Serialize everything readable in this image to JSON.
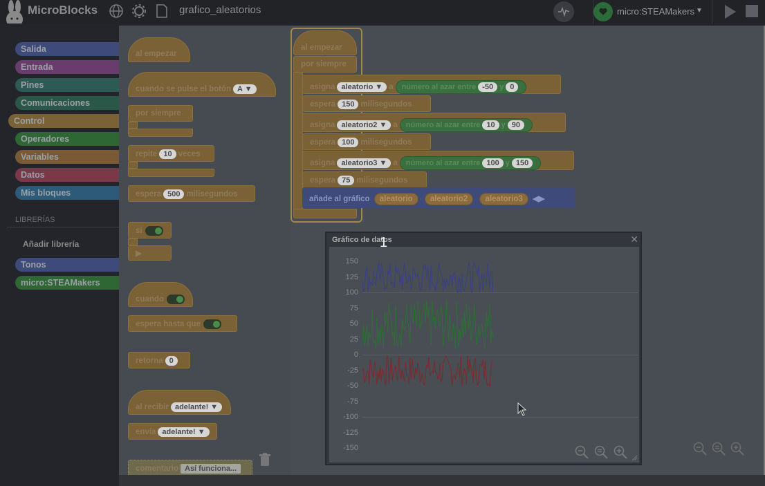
{
  "topbar": {
    "app_title": "MicroBlocks",
    "project_name": "grafico_aleatorios",
    "board_name": "micro:STEAMakers",
    "icons": [
      "globe-icon",
      "gear-icon",
      "file-icon",
      "graph-icon",
      "play-icon",
      "stop-icon"
    ]
  },
  "categories": [
    {
      "label": "Salida",
      "color": "#3e4a7a"
    },
    {
      "label": "Entrada",
      "color": "#6a3c6e"
    },
    {
      "label": "Pines",
      "color": "#2e5a56"
    },
    {
      "label": "Comunicaciones",
      "color": "#2a5848"
    },
    {
      "label": "Control",
      "color": "#7a6136"
    },
    {
      "label": "Operadores",
      "color": "#2e6634"
    },
    {
      "label": "Variables",
      "color": "#7a5a34"
    },
    {
      "label": "Datos",
      "color": "#7a3848"
    },
    {
      "label": "Mis bloques",
      "color": "#2e5a7a"
    }
  ],
  "libraries": {
    "title": "LIBRERÍAS",
    "add_label": "Añadir librería",
    "items": [
      {
        "label": "Tonos",
        "color": "#3e4a7a"
      },
      {
        "label": "micro:STEAMakers",
        "color": "#2e6634"
      }
    ]
  },
  "palette": {
    "when_started": "al empezar",
    "when_button": "cuando se pulse el botón",
    "button_value": "A",
    "forever": "por siempre",
    "repeat_pre": "repite",
    "repeat_value": "10",
    "repeat_post": "veces",
    "wait_pre": "espera",
    "wait_value": "500",
    "wait_post": "milisegundos",
    "if": "si",
    "when": "cuando",
    "wait_until": "espera hasta que",
    "return": "retorna",
    "return_value": "0",
    "when_receive": "al recibir",
    "receive_value": "adelante!",
    "send": "envía",
    "send_value": "adelante!",
    "comment": "comentario",
    "comment_value": "Así funciona..."
  },
  "script": {
    "hat": "al empezar",
    "forever": "por siempre",
    "assign": "asigna",
    "to": "a",
    "random": "número al azar entre",
    "and": "y",
    "wait": "espera",
    "ms": "milisegundos",
    "var1": "aleatorio",
    "var2": "aleatorio2",
    "var3": "aleatorio3",
    "r1_min": "-50",
    "r1_max": "0",
    "r2_min": "10",
    "r2_max": "90",
    "r3_min": "100",
    "r3_max": "150",
    "w1": "150",
    "w2": "100",
    "w3": "75",
    "add_graph": "añade al gráfico"
  },
  "graph": {
    "title": "Gráfico de datos",
    "marker": "1",
    "y_ticks": [
      "150",
      "125",
      "100",
      "75",
      "50",
      "25",
      "0",
      "-25",
      "-50",
      "-75",
      "-100",
      "-125",
      "-150"
    ],
    "colors": {
      "s1": "#7b2a2e",
      "s2": "#2e6e36",
      "s3": "#3a3f86"
    }
  },
  "chart_data": {
    "type": "line",
    "ylim": [
      -150,
      150
    ],
    "series": [
      {
        "name": "aleatorio",
        "range": [
          -50,
          0
        ]
      },
      {
        "name": "aleatorio2",
        "range": [
          10,
          90
        ]
      },
      {
        "name": "aleatorio3",
        "range": [
          100,
          150
        ]
      }
    ]
  }
}
